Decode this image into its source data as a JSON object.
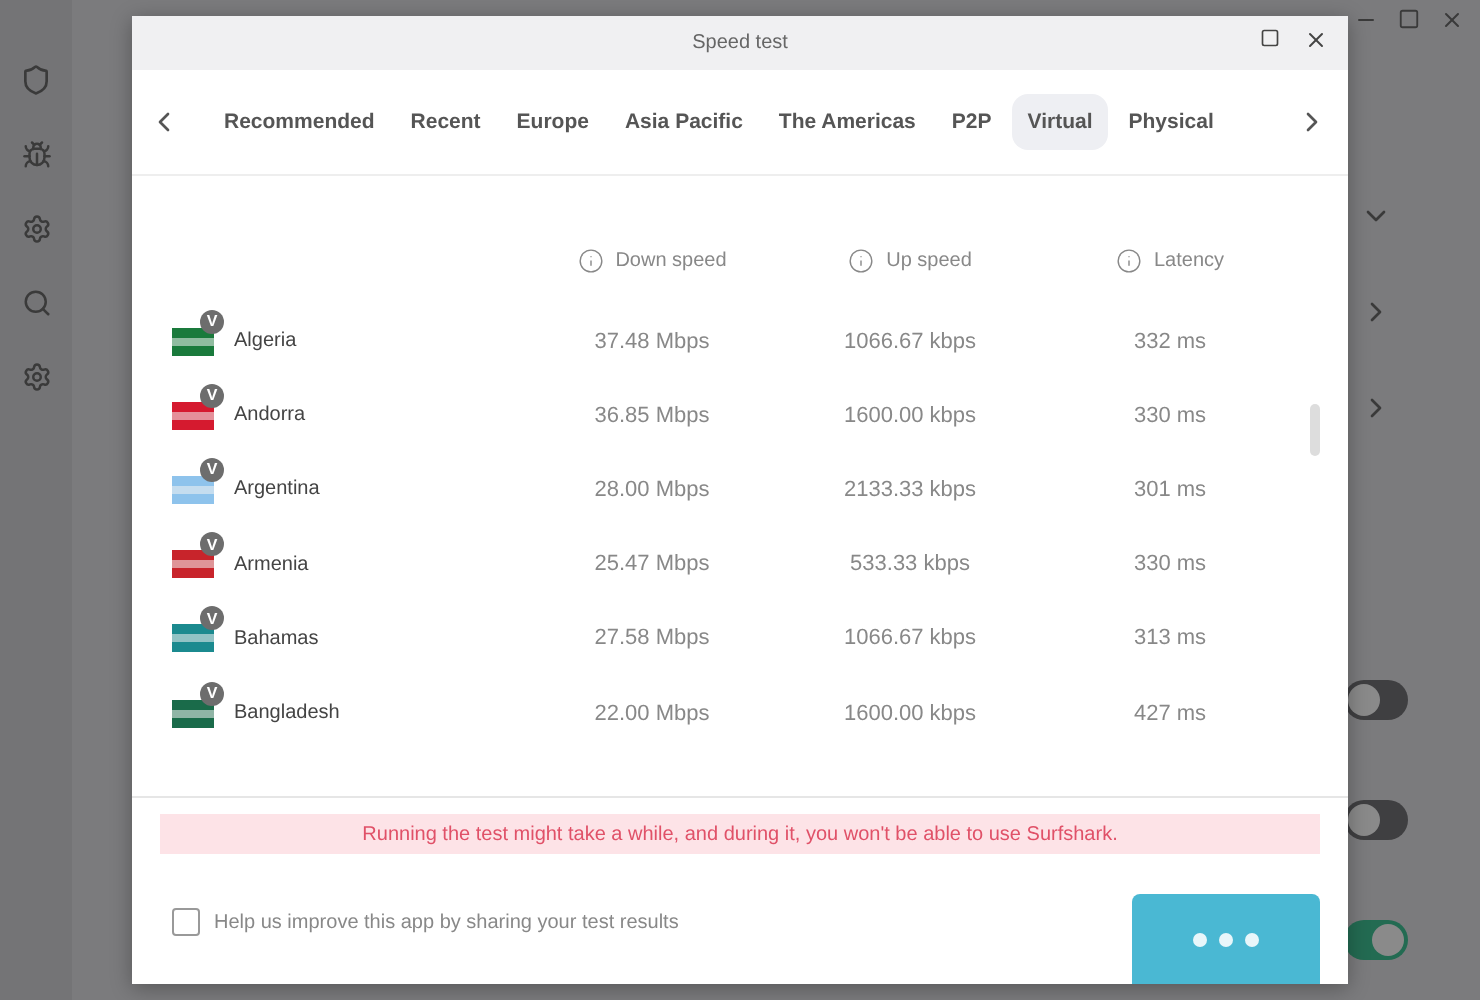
{
  "dialog": {
    "title": "Speed test"
  },
  "tabs": [
    {
      "label": "Recommended",
      "selected": false
    },
    {
      "label": "Recent",
      "selected": false
    },
    {
      "label": "Europe",
      "selected": false
    },
    {
      "label": "Asia Pacific",
      "selected": false
    },
    {
      "label": "The Americas",
      "selected": false
    },
    {
      "label": "P2P",
      "selected": false
    },
    {
      "label": "Virtual",
      "selected": true
    },
    {
      "label": "Physical",
      "selected": false
    }
  ],
  "table": {
    "columns": [
      "Down speed",
      "Up speed",
      "Latency"
    ],
    "rows": [
      {
        "country": "Algeria",
        "badge": "V",
        "color": "#1a7a3c",
        "down": "37.48 Mbps",
        "up": "1066.67 kbps",
        "latency": "332 ms"
      },
      {
        "country": "Andorra",
        "badge": "V",
        "color": "#d51a2f",
        "down": "36.85 Mbps",
        "up": "1600.00 kbps",
        "latency": "330 ms"
      },
      {
        "country": "Argentina",
        "badge": "V",
        "color": "#8ec3ec",
        "down": "28.00 Mbps",
        "up": "2133.33 kbps",
        "latency": "301 ms"
      },
      {
        "country": "Armenia",
        "badge": "V",
        "color": "#c8242b",
        "down": "25.47 Mbps",
        "up": "533.33 kbps",
        "latency": "330 ms"
      },
      {
        "country": "Bahamas",
        "badge": "V",
        "color": "#1b8a8f",
        "down": "27.58 Mbps",
        "up": "1066.67 kbps",
        "latency": "313 ms"
      },
      {
        "country": "Bangladesh",
        "badge": "V",
        "color": "#1a6b4a",
        "down": "22.00 Mbps",
        "up": "1600.00 kbps",
        "latency": "427 ms"
      }
    ]
  },
  "warning": "Running the test might take a while, and during it, you won't be able to use Surfshark.",
  "share_results": {
    "label": "Help us improve this app by sharing your test results",
    "checked": false
  },
  "background_toggles": [
    {
      "on": false
    },
    {
      "on": false
    },
    {
      "on": true
    }
  ]
}
